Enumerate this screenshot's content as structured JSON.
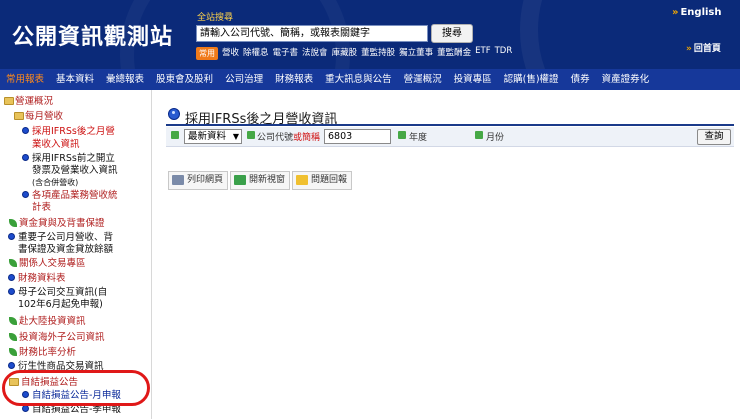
{
  "header": {
    "logo": "公開資訊觀測站",
    "search_label": "全站搜尋",
    "search_value": "請輸入公司代號、簡稱，或報表關鍵字",
    "search_button": "搜尋",
    "quick_badge": "常用",
    "quick_links": [
      "營收",
      "除權息",
      "電子書",
      "法說會",
      "庫藏股",
      "董監持股",
      "獨立董事",
      "董監酬金",
      "ETF",
      "TDR"
    ],
    "english": "English",
    "home": "回首頁"
  },
  "mainnav": [
    {
      "label": "常用報表",
      "active": true
    },
    {
      "label": "基本資料",
      "active": false
    },
    {
      "label": "彙總報表",
      "active": false
    },
    {
      "label": "股東會及股利",
      "active": false
    },
    {
      "label": "公司治理",
      "active": false
    },
    {
      "label": "財務報表",
      "active": false
    },
    {
      "label": "重大訊息與公告",
      "active": false
    },
    {
      "label": "營運概況",
      "active": false
    },
    {
      "label": "投資專區",
      "active": false
    },
    {
      "label": "認購(售)權證",
      "active": false
    },
    {
      "label": "債券",
      "active": false
    },
    {
      "label": "資產證券化",
      "active": false
    }
  ],
  "sidebar": {
    "root": "營運概況",
    "monthly_revenue": "每月營收",
    "ifrs_after_1": "採用IFRSs後之月營",
    "ifrs_after_2": "業收入資訊",
    "ifrs_before_1": "採用IFRSs前之開立",
    "ifrs_before_2": "發票及營業收入資訊",
    "ifrs_before_3": "(含合併營收)",
    "product_1": "各項產品業務營收統",
    "product_2": "計表",
    "lending": "資金貸與及背書保證",
    "subsidiary_1": "重要子公司月營收、背",
    "subsidiary_2": "書保證及資金貸放餘額",
    "related": "關係人交易專區",
    "financial_sheets": "財務資料表",
    "parent_sub_1": "母子公司交互資訊(自",
    "parent_sub_2": "102年6月起免申報)",
    "mainland": "赴大陸投資資訊",
    "overseas": "投資海外子公司資訊",
    "ratio": "財務比率分析",
    "derivatives": "衍生性商品交易資訊",
    "self_profit": "自結損益公告",
    "self_monthly": "自結損益公告-月申報",
    "self_quarterly": "自結損益公告-季申報"
  },
  "content": {
    "title": "採用IFRSs後之月營收資訊",
    "select_value": "最新資料",
    "company_label": "公司代號",
    "company_label_red": "或簡稱",
    "company_value": "6803",
    "year_label": "年度",
    "month_label": "月份",
    "query_button": "查詢",
    "actions": [
      "列印網頁",
      "開新視窗",
      "問題回報"
    ]
  },
  "colors": {
    "header_bg": "#0b2a79",
    "nav_bg": "#16389a",
    "nav_active": "#ff8a1a",
    "highlight_ring": "#e01818"
  }
}
